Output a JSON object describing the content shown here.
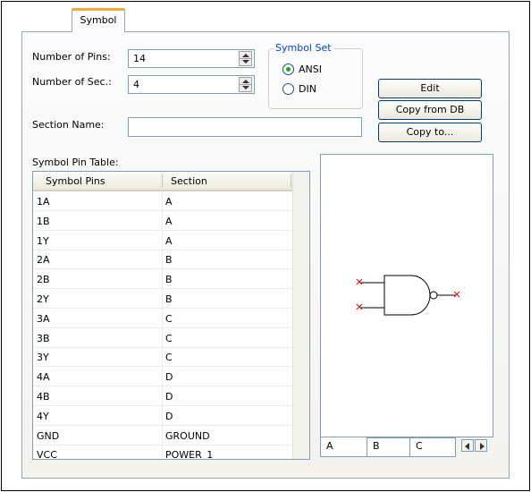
{
  "tabs": {
    "symbol": "Symbol"
  },
  "form": {
    "num_pins_label": "Number of Pins:",
    "num_pins_value": "14",
    "num_sec_label": "Number of Sec.:",
    "num_sec_value": "4",
    "section_name_label": "Section Name:",
    "section_name_value": ""
  },
  "symbol_set": {
    "title": "Symbol Set",
    "options": [
      "ANSI",
      "DIN"
    ],
    "selected": "ANSI"
  },
  "buttons": {
    "edit": "Edit",
    "copy_from_db": "Copy from DB",
    "copy_to": "Copy to..."
  },
  "pin_table": {
    "label": "Symbol Pin Table:",
    "columns": [
      "Symbol Pins",
      "Section"
    ],
    "rows": [
      [
        "1A",
        "A"
      ],
      [
        "1B",
        "A"
      ],
      [
        "1Y",
        "A"
      ],
      [
        "2A",
        "B"
      ],
      [
        "2B",
        "B"
      ],
      [
        "2Y",
        "B"
      ],
      [
        "3A",
        "C"
      ],
      [
        "3B",
        "C"
      ],
      [
        "3Y",
        "C"
      ],
      [
        "4A",
        "D"
      ],
      [
        "4B",
        "D"
      ],
      [
        "4Y",
        "D"
      ],
      [
        "GND",
        "GROUND"
      ],
      [
        "VCC",
        "POWER_1"
      ]
    ]
  },
  "section_tabs": [
    "A",
    "B",
    "C"
  ],
  "colors": {
    "accent_tab": "#f2a83b",
    "group_title": "#0046d5",
    "pin_marker": "#dd0000",
    "radio_selected": "#21a121"
  }
}
